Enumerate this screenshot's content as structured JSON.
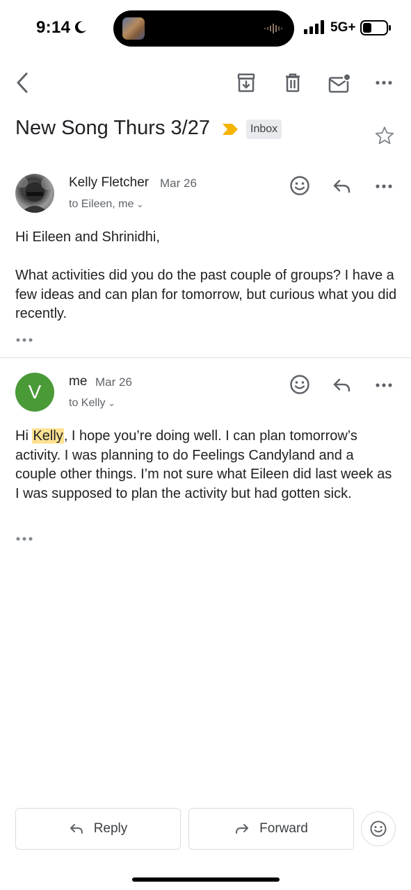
{
  "status_bar": {
    "time": "9:14",
    "network": "5G+",
    "icons": [
      "moon-icon",
      "audio-wave-icon",
      "cell-signal-icon",
      "battery-icon"
    ]
  },
  "toolbar": {
    "icons": [
      "back-arrow-icon",
      "archive-icon",
      "trash-icon",
      "mark-unread-icon",
      "more-vert-icon"
    ]
  },
  "thread": {
    "subject": "New Song Thurs 3/27",
    "label": "Inbox",
    "importance_color": "#f4b400"
  },
  "messages": [
    {
      "avatar_letter": "",
      "sender": "Kelly Fletcher",
      "date": "Mar 26",
      "recipients": "to Eileen, me",
      "greeting": "Hi Eileen and Shrinidhi,",
      "body": "What activities did you do the past couple of groups? I have a few ideas and can plan for tomorrow, but curious what you did recently."
    },
    {
      "avatar_letter": "V",
      "avatar_color": "#4a9a37",
      "sender": "me",
      "date": "Mar 26",
      "recipients": "to Kelly",
      "body_prefix": "Hi ",
      "body_highlight": "Kelly",
      "body_rest": ", I hope you’re doing well. I can plan tomorrow’s activity. I was planning to do Feelings Candyland and a couple other things. I’m not sure what Eileen did last week as I was supposed to plan the activity but had gotten sick."
    }
  ],
  "bottom_actions": {
    "reply_label": "Reply",
    "forward_label": "Forward"
  },
  "colors": {
    "highlight": "#fde293",
    "accent": "#4a9a37"
  }
}
